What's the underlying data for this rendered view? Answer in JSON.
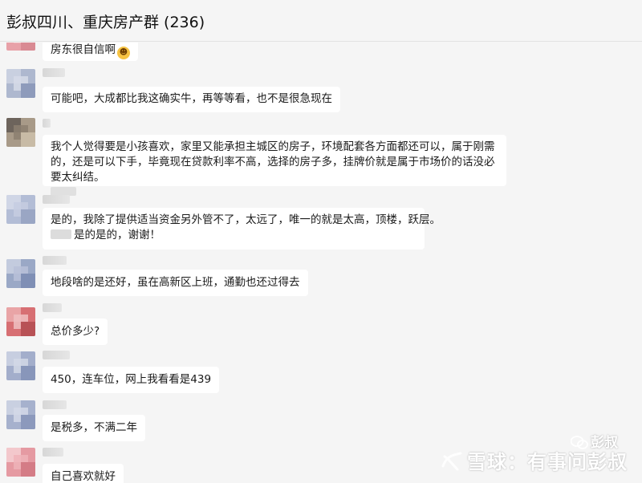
{
  "header": {
    "title": "彭叔四川、重庆房产群 (236)"
  },
  "messages": [
    {
      "text": "房东很自信啊",
      "emoji": "grinning-face-emoji",
      "avatar_colors": [
        "#e8a1a8",
        "#f2c5ca",
        "#d98a93",
        "#efb6bc"
      ]
    },
    {
      "text": "可能吧，大成都比我这确实牛，再等等看，也不是很急现在",
      "avatar_colors": [
        "#aeb8cf",
        "#c9d0e0",
        "#8e9bbb",
        "#d6dbe7"
      ]
    },
    {
      "text": "我个人觉得要是小孩喜欢，家里又能承担主城区的房子，环境配套各方面都还可以，属于刚需的，还是可以下手，毕竟现在贷款利率不高，选择的房子多，挂牌价就是属于市场价的话没必要太纠结。",
      "avatar_colors": [
        "#a89a88",
        "#6d645c",
        "#c8bba6",
        "#8c7f70"
      ]
    },
    {
      "text": "是的，我除了提供适当资金另外管不了，太远了，唯一的就是太高，顶楼，跃层。",
      "reply_text": "是的是的，谢谢！",
      "avatar_colors": [
        "#b3bdd6",
        "#d0d6e6",
        "#9aa6c4",
        "#c5cde0"
      ]
    },
    {
      "text": "地段啥的是还好，虽在高新区上班，通勤也还过得去",
      "avatar_colors": [
        "#9aa8c6",
        "#c3cbde",
        "#7f8fb5",
        "#b8c1d8"
      ]
    },
    {
      "text": "总价多少?",
      "avatar_colors": [
        "#d76f73",
        "#e9a4a6",
        "#b85256",
        "#f0c0c1"
      ]
    },
    {
      "text": "450，连车位，网上我看看是439",
      "avatar_colors": [
        "#a3aecb",
        "#c7cee0",
        "#8896ba",
        "#d2d8e6"
      ]
    },
    {
      "text": "是税多，不满二年",
      "avatar_colors": [
        "#a6b1cd",
        "#c9d0e1",
        "#8c99bc",
        "#d4d9e7"
      ]
    },
    {
      "text": "自己喜欢就好",
      "avatar_colors": [
        "#e59aa2",
        "#f3c8cc",
        "#d47c86",
        "#eeb3b9"
      ]
    }
  ],
  "watermark": {
    "top_text": "彭叔",
    "bottom_text": "雪球：有事问彭叔",
    "logo": "xueqiu-snowball-logo",
    "top_icon": "wechat-icon"
  }
}
